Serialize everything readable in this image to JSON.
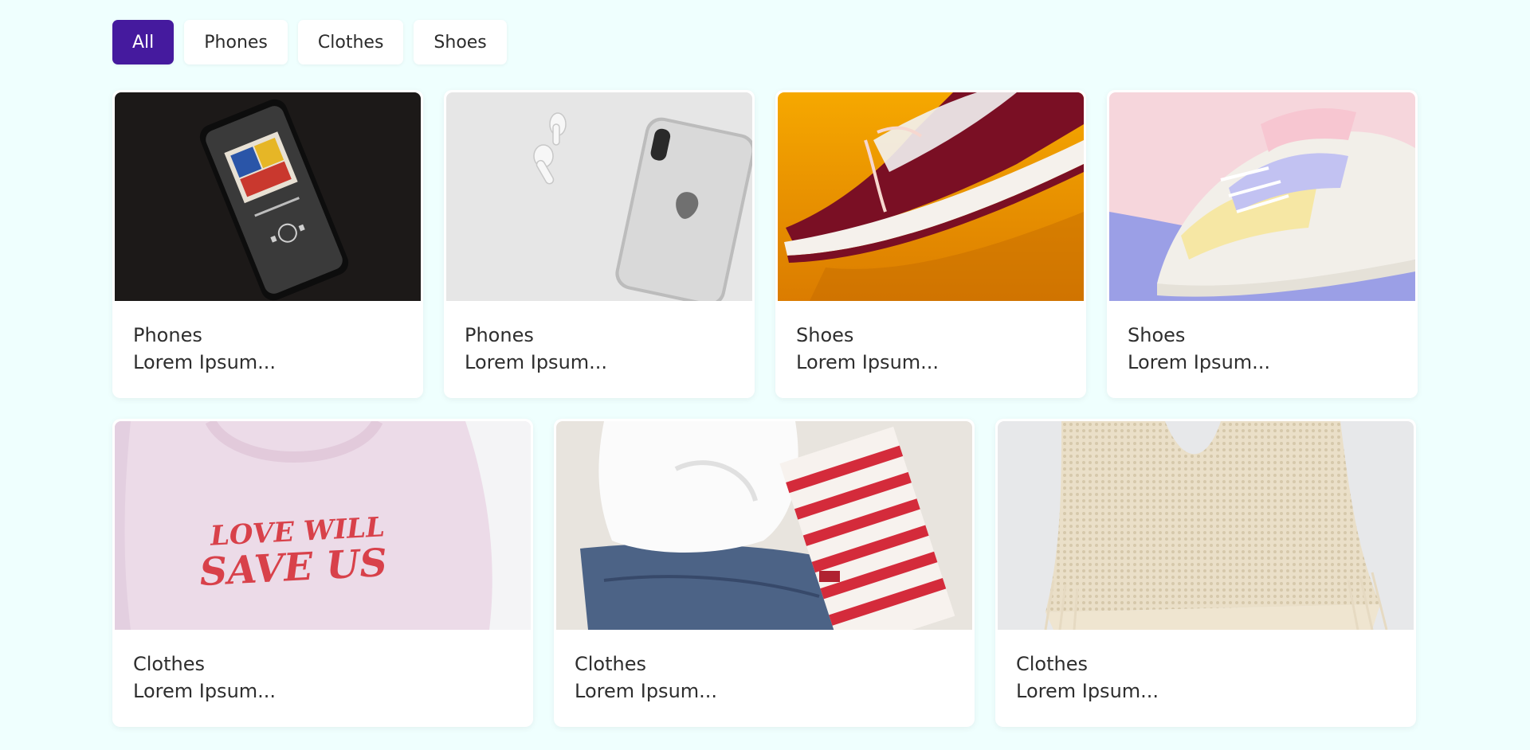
{
  "filters": {
    "all": "All",
    "phones": "Phones",
    "clothes": "Clothes",
    "shoes": "Shoes"
  },
  "accent_color": "#451a9e",
  "products": [
    {
      "category": "Phones",
      "description": "Lorem Ipsum...",
      "image": "phone-music-photo"
    },
    {
      "category": "Phones",
      "description": "Lorem Ipsum...",
      "image": "iphone-airpods-photo"
    },
    {
      "category": "Shoes",
      "description": "Lorem Ipsum...",
      "image": "red-sneaker-photo"
    },
    {
      "category": "Shoes",
      "description": "Lorem Ipsum...",
      "image": "pastel-sneakers-photo"
    },
    {
      "category": "Clothes",
      "description": "Lorem Ipsum...",
      "image": "pink-sweatshirt-photo"
    },
    {
      "category": "Clothes",
      "description": "Lorem Ipsum...",
      "image": "folded-clothes-photo"
    },
    {
      "category": "Clothes",
      "description": "Lorem Ipsum...",
      "image": "knit-top-photo"
    }
  ],
  "sweatshirt_text": {
    "line1": "LOVE WILL",
    "line2": "SAVE US"
  }
}
